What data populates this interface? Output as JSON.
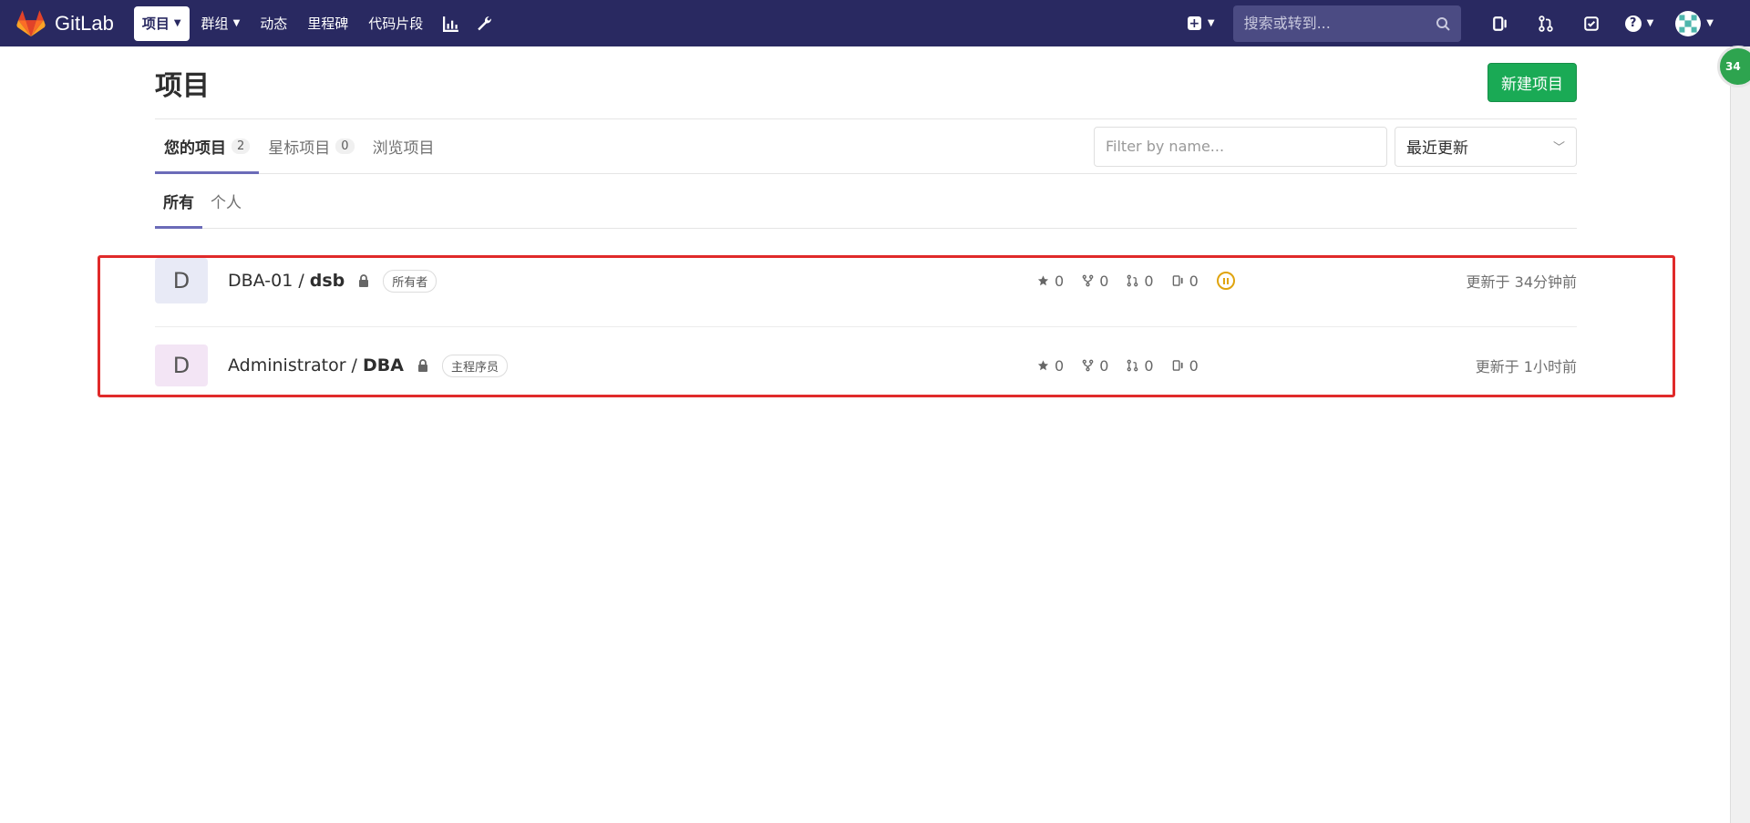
{
  "navbar": {
    "brand": "GitLab",
    "items": [
      {
        "label": "项目",
        "active": true,
        "dropdown": true
      },
      {
        "label": "群组",
        "active": false,
        "dropdown": true
      },
      {
        "label": "动态",
        "active": false,
        "dropdown": false
      },
      {
        "label": "里程碑",
        "active": false,
        "dropdown": false
      },
      {
        "label": "代码片段",
        "active": false,
        "dropdown": false
      }
    ],
    "search_placeholder": "搜索或转到...",
    "icons": [
      "chart-icon",
      "wrench-icon",
      "plus-icon",
      "search-icon",
      "issues-icon",
      "merge-request-icon",
      "todo-icon",
      "help-icon",
      "avatar"
    ],
    "colors": {
      "navbar_bg": "#292961",
      "accent": "#1aaa55"
    },
    "side_badge": "34"
  },
  "page": {
    "title": "项目",
    "new_project_button": "新建项目",
    "tabs": [
      {
        "label": "您的项目",
        "count": "2",
        "active": true
      },
      {
        "label": "星标项目",
        "count": "0",
        "active": false
      },
      {
        "label": "浏览项目",
        "count": null,
        "active": false
      }
    ],
    "filter_placeholder": "Filter by name...",
    "sort_selected": "最近更新",
    "subtabs": [
      {
        "label": "所有",
        "active": true
      },
      {
        "label": "个人",
        "active": false
      }
    ]
  },
  "projects": [
    {
      "avatar_letter": "D",
      "namespace": "DBA-01 /",
      "name": "dsb",
      "role": "所有者",
      "stars": "0",
      "forks": "0",
      "merge_requests": "0",
      "issues": "0",
      "pipeline_status": "paused",
      "updated": "更新于 34分钟前"
    },
    {
      "avatar_letter": "D",
      "namespace": "Administrator /",
      "name": "DBA",
      "role": "主程序员",
      "stars": "0",
      "forks": "0",
      "merge_requests": "0",
      "issues": "0",
      "pipeline_status": null,
      "updated": "更新于 1小时前"
    }
  ]
}
